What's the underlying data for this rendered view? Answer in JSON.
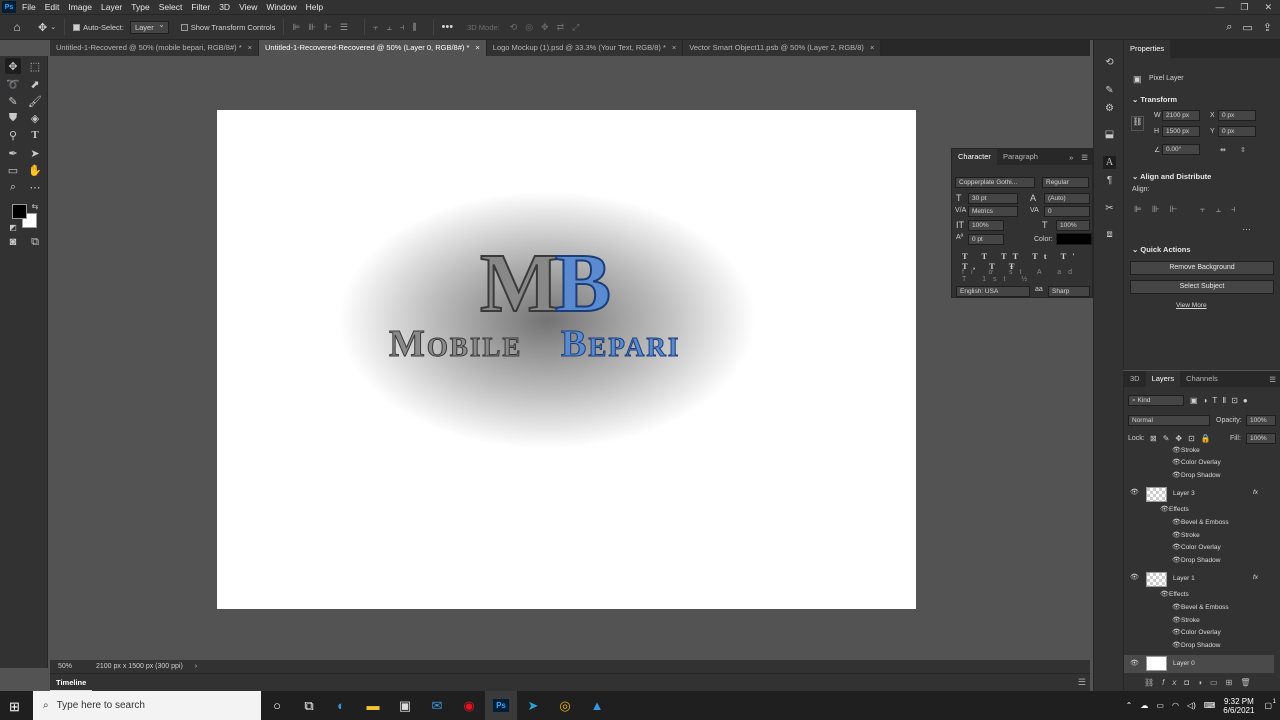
{
  "app": {
    "logo": "Ps"
  },
  "menu": [
    "File",
    "Edit",
    "Image",
    "Layer",
    "Type",
    "Select",
    "Filter",
    "3D",
    "View",
    "Window",
    "Help"
  ],
  "options": {
    "auto_select_label": "Auto-Select:",
    "auto_select_value": "Layer",
    "transform_label": "Show Transform Controls",
    "mode_label": "3D Mode:"
  },
  "tabs": [
    {
      "label": "Untitled-1-Recovered @ 50% (mobile bepari, RGB/8#) *"
    },
    {
      "label": "Untitled-1-Recovered-Recovered @ 50% (Layer 0, RGB/8#) *"
    },
    {
      "label": "Logo Mockup (1).psd @ 33.3% (Your Text, RGB/8) *"
    },
    {
      "label": "Vector Smart Object11.psb @ 50% (Layer 2, RGB/8)"
    }
  ],
  "status": {
    "zoom": "50%",
    "doc_size": "2100 px x 1500 px (300 ppi)"
  },
  "timeline": {
    "label": "Timeline"
  },
  "character": {
    "tab_character": "Character",
    "tab_paragraph": "Paragraph",
    "font_family": "Copperplate Gothi...",
    "font_style": "Regular",
    "size": "30 pt",
    "leading": "(Auto)",
    "kerning": "Metrics",
    "tracking": "0",
    "vscale": "100%",
    "hscale": "100%",
    "baseline": "0 pt",
    "color_label": "Color:",
    "language": "English: USA",
    "aa_icon": "aa",
    "antialias": "Sharp"
  },
  "properties": {
    "title": "Properties",
    "type": "Pixel Layer",
    "transform": "Transform",
    "w_label": "W",
    "w": "2100 px",
    "h_label": "H",
    "h": "1500 px",
    "x_label": "X",
    "x": "0 px",
    "y_label": "Y",
    "y": "0 px",
    "angle": "0.00°",
    "align_title": "Align and Distribute",
    "align_label": "Align:",
    "quick_title": "Quick Actions",
    "remove_bg": "Remove Background",
    "select_subject": "Select Subject",
    "view_more": "View More"
  },
  "layers_panel": {
    "tab_3d": "3D",
    "tab_layers": "Layers",
    "tab_channels": "Channels",
    "kind": "Kind",
    "blend": "Normal",
    "opacity_label": "Opacity:",
    "opacity": "100%",
    "lock_label": "Lock:",
    "fill_label": "Fill:",
    "fill": "100%",
    "fx_icon": "fx",
    "items": [
      {
        "name": "Stroke"
      },
      {
        "name": "Color Overlay"
      },
      {
        "name": "Drop Shadow"
      },
      {
        "name": "Layer 3"
      },
      {
        "name": "Effects"
      },
      {
        "name": "Bevel & Emboss"
      },
      {
        "name": "Stroke"
      },
      {
        "name": "Color Overlay"
      },
      {
        "name": "Drop Shadow"
      },
      {
        "name": "Layer 1"
      },
      {
        "name": "Effects"
      },
      {
        "name": "Bevel & Emboss"
      },
      {
        "name": "Stroke"
      },
      {
        "name": "Color Overlay"
      },
      {
        "name": "Drop Shadow"
      },
      {
        "name": "Layer 0"
      }
    ]
  },
  "logo_art": {
    "m": "M",
    "b": "B",
    "word1": "Mobile",
    "word2": "Bepari"
  },
  "taskbar": {
    "search_placeholder": "Type here to search",
    "time": "9:32 PM",
    "date": "6/6/2021",
    "notifications": "1"
  },
  "colors": {
    "accent_blue": "#5a8ad0",
    "ui_dark": "#323232",
    "canvas_bg": "#535353"
  }
}
